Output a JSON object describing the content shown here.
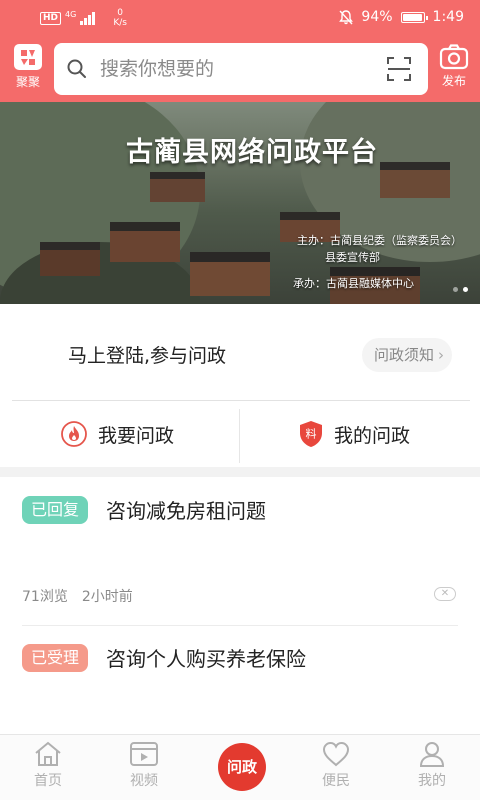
{
  "status_bar": {
    "network_badge": "HD",
    "network_type": "4G",
    "speed_value": "0",
    "speed_unit": "K/s",
    "battery": "94%",
    "battery_level": 0.94,
    "time": "1:49"
  },
  "header": {
    "logo_label": "聚聚",
    "search_placeholder": "搜索你想要的",
    "publish_label": "发布"
  },
  "banner": {
    "title": "古蔺县网络问政平台",
    "host_line1": "主办：古蔺县纪委（监察委员会）",
    "host_line2": "县委宣传部",
    "organizer": "承办：古蔺县融媒体中心",
    "slide_count": 2,
    "active_slide": 1
  },
  "login": {
    "prompt": "马上登陆,参与问政",
    "notice_button": "问政须知"
  },
  "actions": {
    "ask": "我要问政",
    "mine": "我的问政",
    "mine_icon_char": "料"
  },
  "posts": [
    {
      "status": "已回复",
      "title": "咨询减免房租问题",
      "views": "71浏览",
      "time": "2小时前"
    },
    {
      "status": "已受理",
      "title": "咨询个人购买养老保险"
    }
  ],
  "bottom_nav": {
    "home": "首页",
    "video": "视频",
    "center": "问政",
    "service": "便民",
    "mine": "我的"
  },
  "colors": {
    "brand_red": "#f46b6a",
    "replied_badge": "#6fd3b8",
    "accepted_badge": "#f59a8a",
    "center_button": "#e33a2f"
  }
}
